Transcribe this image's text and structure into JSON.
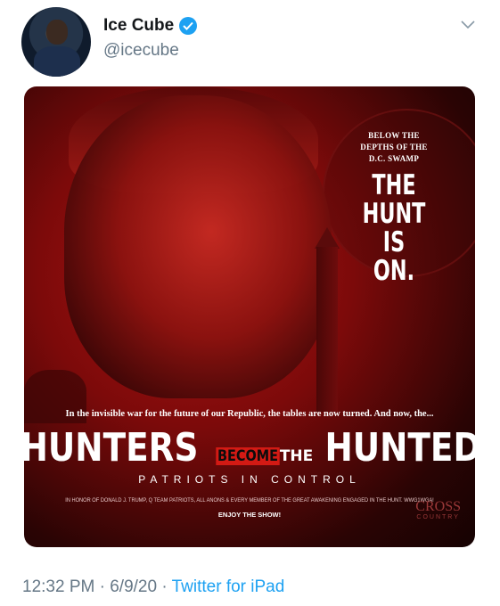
{
  "tweet": {
    "author_name": "Ice Cube",
    "handle": "@icecube",
    "verified_icon": "verified-badge-icon",
    "menu_icon": "chevron-down-icon",
    "time": "12:32 PM",
    "separator": "·",
    "date": "6/9/20",
    "source": "Twitter for iPad"
  },
  "poster": {
    "below_line1": "BELOW THE",
    "below_line2": "DEPTHS OF THE",
    "below_line3": "D.C. SWAMP",
    "hunt_line1": "THE",
    "hunt_line2": "HUNT",
    "hunt_line3": "IS",
    "hunt_line4": "ON.",
    "invisible_war": "In the invisible war for the future of our Republic, the tables are now turned. And now, the...",
    "title_hunters": "HUNTERS",
    "title_become": "BECOME",
    "title_the": "THE",
    "title_hunted": "HUNTED",
    "tagline": "PATRIOTS IN CONTROL",
    "fine_print": "IN HONOR OF DONALD J. TRUMP, Q TEAM PATRIOTS, ALL ANONS & EVERY MEMBER OF THE GREAT AWAKENING ENGAGED IN THE HUNT. WWG1WGA!",
    "enjoy": "ENJOY THE SHOW!",
    "logo_line1": "CROSS",
    "logo_line2": "COUNTRY"
  },
  "colors": {
    "link": "#1da1f2",
    "muted": "#657786",
    "poster_red": "#b21414"
  }
}
